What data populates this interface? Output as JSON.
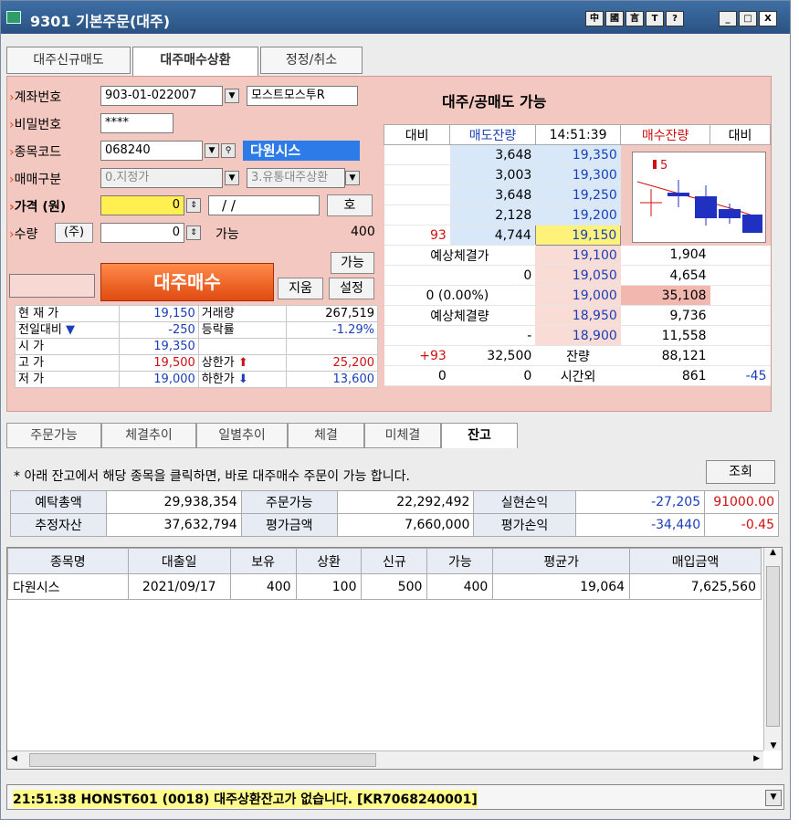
{
  "window": {
    "title": "9301 기본주문(대주)",
    "title_buttons": [
      "中",
      "國",
      "言",
      "T",
      "?",
      "_",
      "□",
      "X"
    ]
  },
  "top_tabs": [
    {
      "label": "대주신규매도"
    },
    {
      "label": "대주매수상환"
    },
    {
      "label": "정정/취소"
    }
  ],
  "form": {
    "account_label": "계좌번호",
    "account_value": "903-01-022007",
    "account_name": "모스트모스투R",
    "password_label": "비밀번호",
    "password_value": "****",
    "code_label": "종목코드",
    "code_value": "068240",
    "stock_name": "다원시스",
    "type_label": "매매구분",
    "type_value": "0.지정가",
    "type_value2": "3.유통대주상환",
    "price_label": "가격 (원)",
    "price_value": "0",
    "date_value": "/ /",
    "price_unit": "호",
    "qty_label": "수량",
    "qty_unit": "(주)",
    "qty_value": "0",
    "avail_label": "가능",
    "avail_value": "400",
    "avail_btn": "가능",
    "buy_btn": "대주매수",
    "clear_btn": "지움",
    "setting_btn": "설정"
  },
  "quote": {
    "rows": [
      {
        "l1": "현 재 가",
        "v1": "19,150",
        "l2": "거래량",
        "v2": "267,519"
      },
      {
        "l1": "전일대비",
        "v1": "-250",
        "l2": "등락률",
        "v2": "-1.29%"
      },
      {
        "l1": "시    가",
        "v1": "19,350",
        "l2": "",
        "v2": ""
      },
      {
        "l1": "고    가",
        "v1": "19,500",
        "l2": "상한가",
        "v2": "25,200"
      },
      {
        "l1": "저    가",
        "v1": "19,000",
        "l2": "하한가",
        "v2": "13,600"
      }
    ]
  },
  "hoga": {
    "title": "대주/공매도 가능",
    "headers": [
      "대비",
      "매도잔량",
      "14:51:39",
      "매수잔량",
      "대비"
    ],
    "sell_rows": [
      {
        "diff": "",
        "qty": "3,648",
        "price": "19,350"
      },
      {
        "diff": "",
        "qty": "3,003",
        "price": "19,300"
      },
      {
        "diff": "",
        "qty": "3,648",
        "price": "19,250"
      },
      {
        "diff": "",
        "qty": "2,128",
        "price": "19,200"
      },
      {
        "diff": "93",
        "qty": "4,744",
        "price": "19,150"
      }
    ],
    "exp_price_label": "예상체결가",
    "exp_price_value": "0",
    "exp_change": "0  (0.00%)",
    "exp_vol_label": "예상체결량",
    "exp_vol_value": "-",
    "buy_rows": [
      {
        "price": "19,100",
        "qty": "1,904"
      },
      {
        "price": "19,050",
        "qty": "4,654"
      },
      {
        "price": "19,000",
        "qty": "35,108"
      },
      {
        "price": "18,950",
        "qty": "9,736"
      },
      {
        "price": "18,900",
        "qty": "11,558"
      }
    ],
    "total_row": {
      "diff": "+93",
      "sell": "32,500",
      "label": "잔량",
      "buy": "88,121"
    },
    "after_row": {
      "diff": "0",
      "sell": "0",
      "label": "시간외",
      "buy": "861",
      "diff2": "-45"
    },
    "chart_label": "5"
  },
  "bottom_tabs": [
    {
      "label": "주문가능"
    },
    {
      "label": "체결추이"
    },
    {
      "label": "일별추이"
    },
    {
      "label": "체결"
    },
    {
      "label": "미체결"
    },
    {
      "label": "잔고"
    }
  ],
  "notice": "* 아래 잔고에서 해당 종목을 클릭하면, 바로 대주매수 주문이 가능 합니다.",
  "query_btn": "조회",
  "balance": [
    {
      "l1": "예탁총액",
      "v1": "29,938,354",
      "l2": "주문가능",
      "v2": "22,292,492",
      "l3": "실현손익",
      "v3": "-27,205",
      "v4": "91000.00"
    },
    {
      "l1": "추정자산",
      "v1": "37,632,794",
      "l2": "평가금액",
      "v2": "7,660,000",
      "l3": "평가손익",
      "v3": "-34,440",
      "v4": "-0.45"
    }
  ],
  "grid": {
    "headers": [
      "종목명",
      "대출일",
      "보유",
      "상환",
      "신규",
      "가능",
      "평균가",
      "매입금액"
    ],
    "rows": [
      [
        "다원시스",
        "2021/09/17",
        "400",
        "100",
        "500",
        "400",
        "19,064",
        "7,625,560"
      ]
    ]
  },
  "status": "21:51:38 HONST601 (0018) 대주상환잔고가 없습니다. [KR7068240001]"
}
